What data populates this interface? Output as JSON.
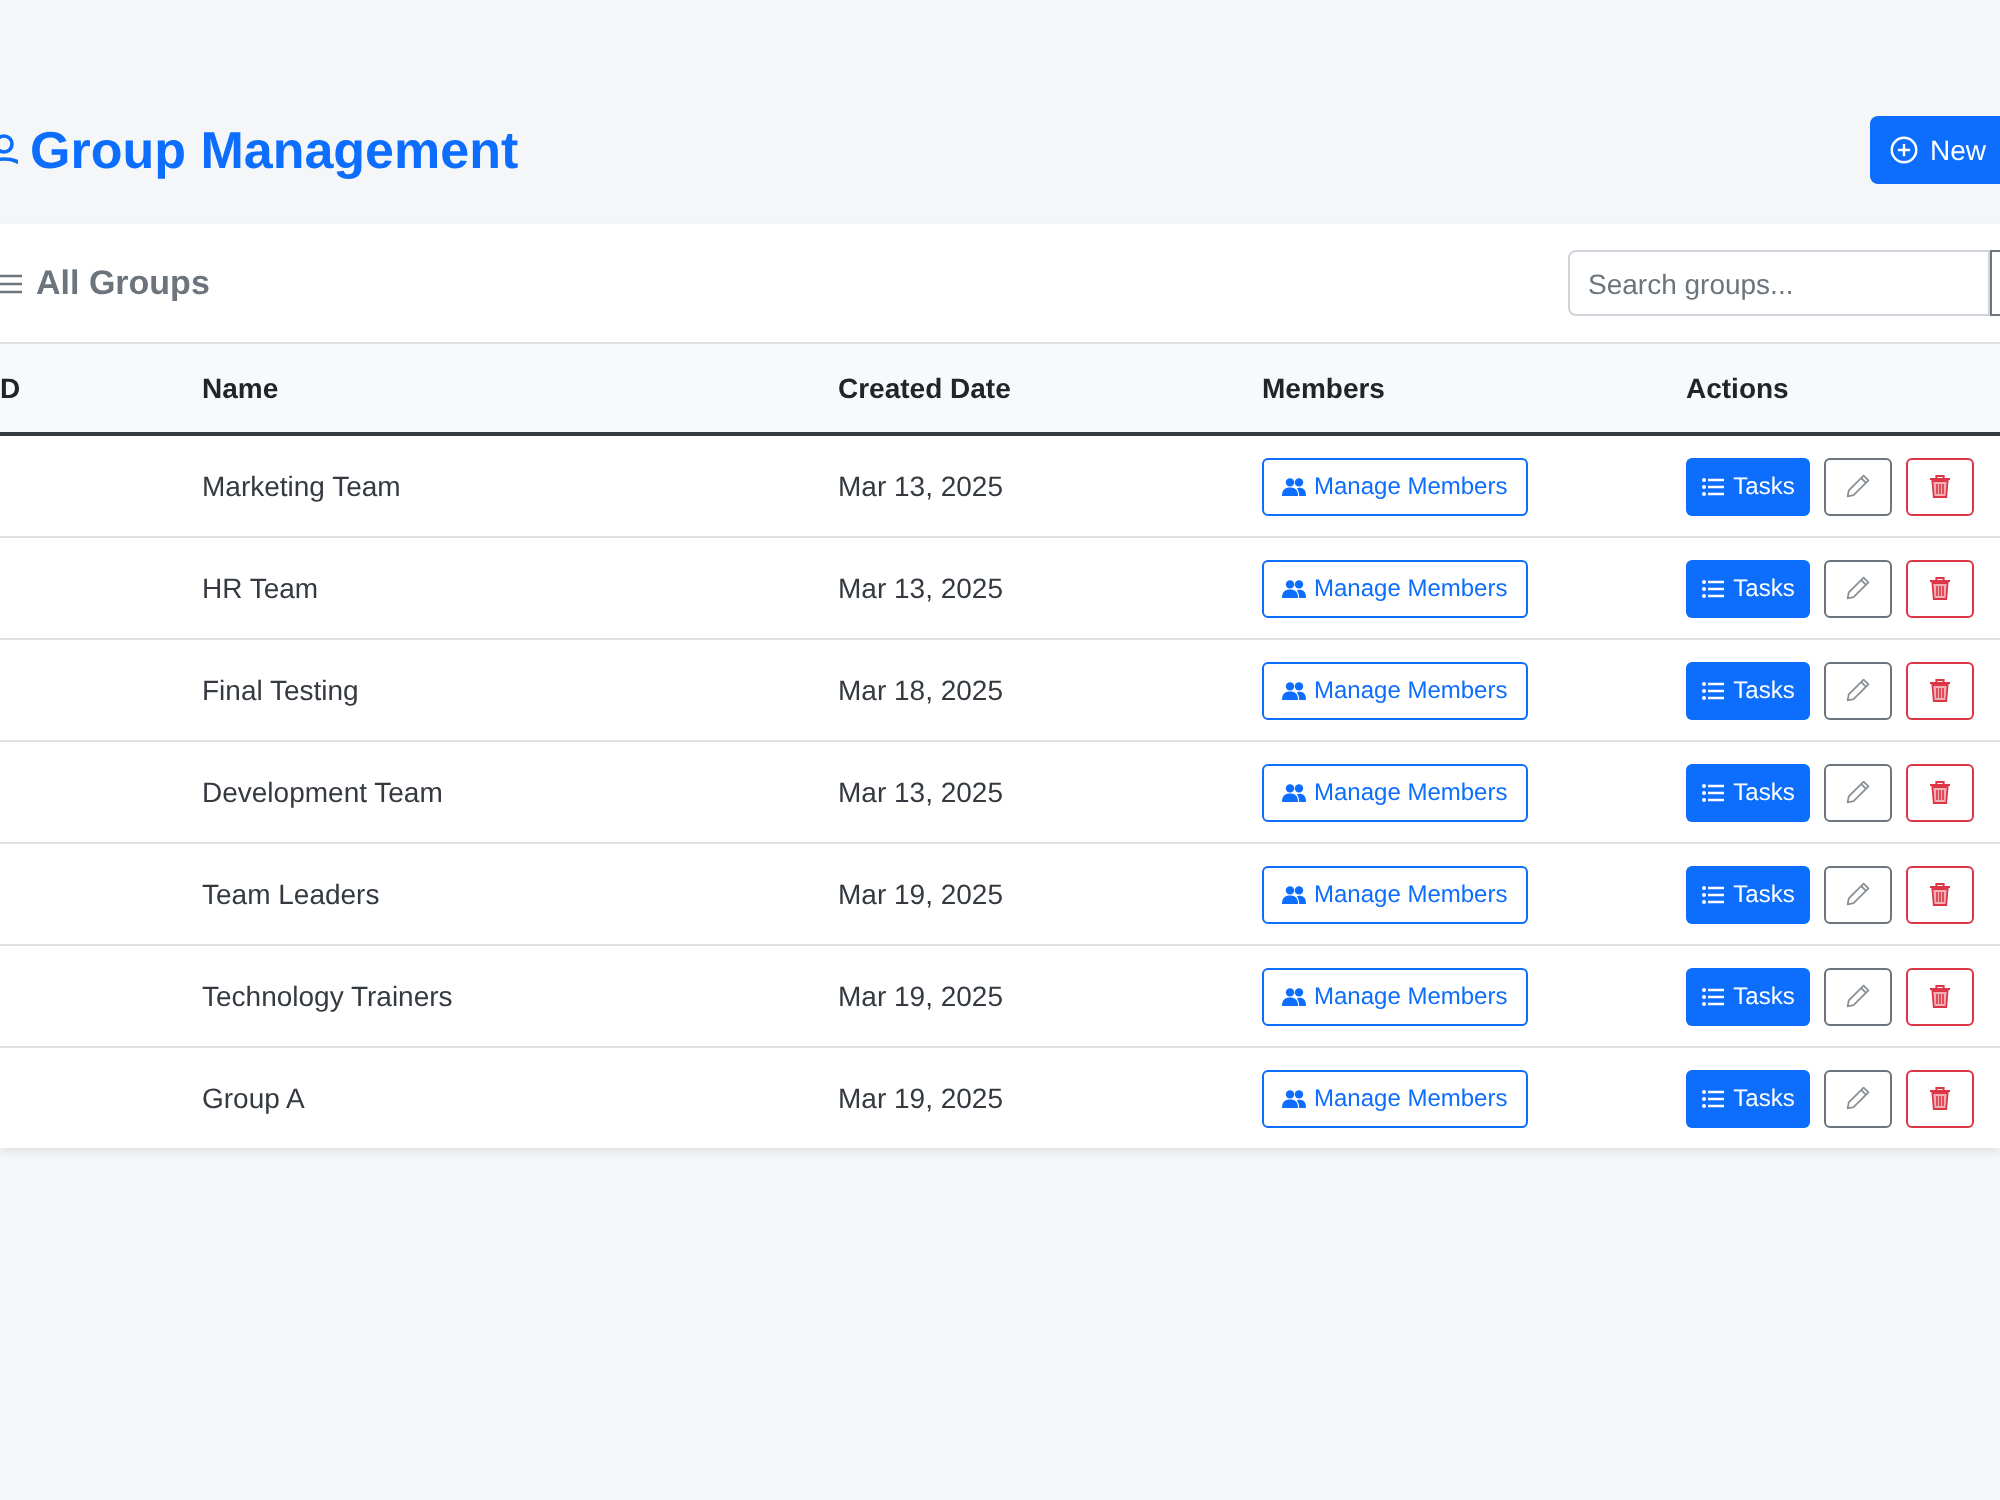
{
  "header": {
    "title": "Group Management",
    "new_button": "New"
  },
  "card": {
    "title": "All Groups",
    "search": {
      "placeholder": "Search groups..."
    }
  },
  "table": {
    "columns": [
      "D",
      "Name",
      "Created Date",
      "Members",
      "Actions"
    ],
    "rows": [
      {
        "name": "Marketing Team",
        "created_date": "Mar 13, 2025",
        "members_button": "Manage Members",
        "tasks_button": "Tasks"
      },
      {
        "name": "HR Team",
        "created_date": "Mar 13, 2025",
        "members_button": "Manage Members",
        "tasks_button": "Tasks"
      },
      {
        "name": "Final Testing",
        "created_date": "Mar 18, 2025",
        "members_button": "Manage Members",
        "tasks_button": "Tasks"
      },
      {
        "name": "Development Team",
        "created_date": "Mar 13, 2025",
        "members_button": "Manage Members",
        "tasks_button": "Tasks"
      },
      {
        "name": "Team Leaders",
        "created_date": "Mar 19, 2025",
        "members_button": "Manage Members",
        "tasks_button": "Tasks"
      },
      {
        "name": "Technology Trainers",
        "created_date": "Mar 19, 2025",
        "members_button": "Manage Members",
        "tasks_button": "Tasks"
      },
      {
        "name": "Group A",
        "created_date": "Mar 19, 2025",
        "members_button": "Manage Members",
        "tasks_button": "Tasks"
      }
    ]
  }
}
